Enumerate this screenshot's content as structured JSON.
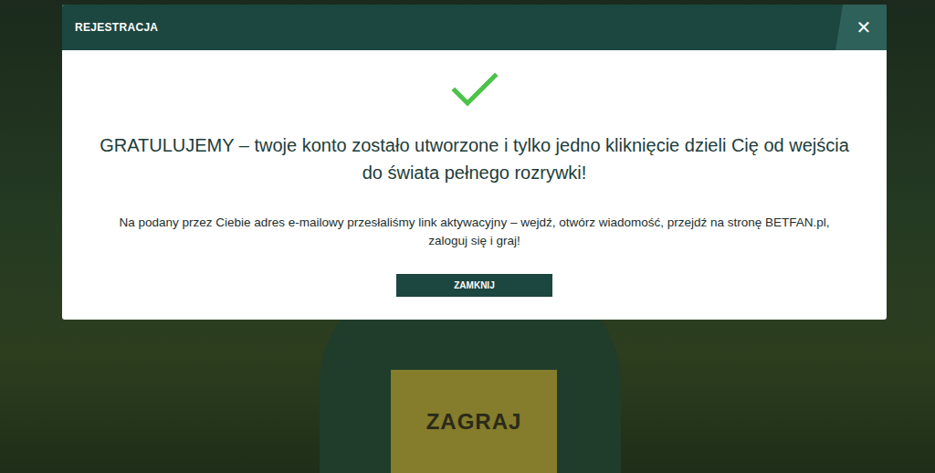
{
  "background": {
    "button": "ZAGRAJ"
  },
  "modal": {
    "title": "REJESTRACJA",
    "close": "✕",
    "heading": "GRATULUJEMY – twoje konto zostało utworzone i tylko jedno kliknięcie dzieli Cię od wejścia do świata pełnego rozrywki!",
    "message": "Na podany przez Ciebie adres e-mailowy przesłaliśmy link aktywacyjny – wejdź, otwórz wiadomość, przejdź na stronę BETFAN.pl, zaloguj się i graj!",
    "button": "ZAMKNIJ"
  }
}
